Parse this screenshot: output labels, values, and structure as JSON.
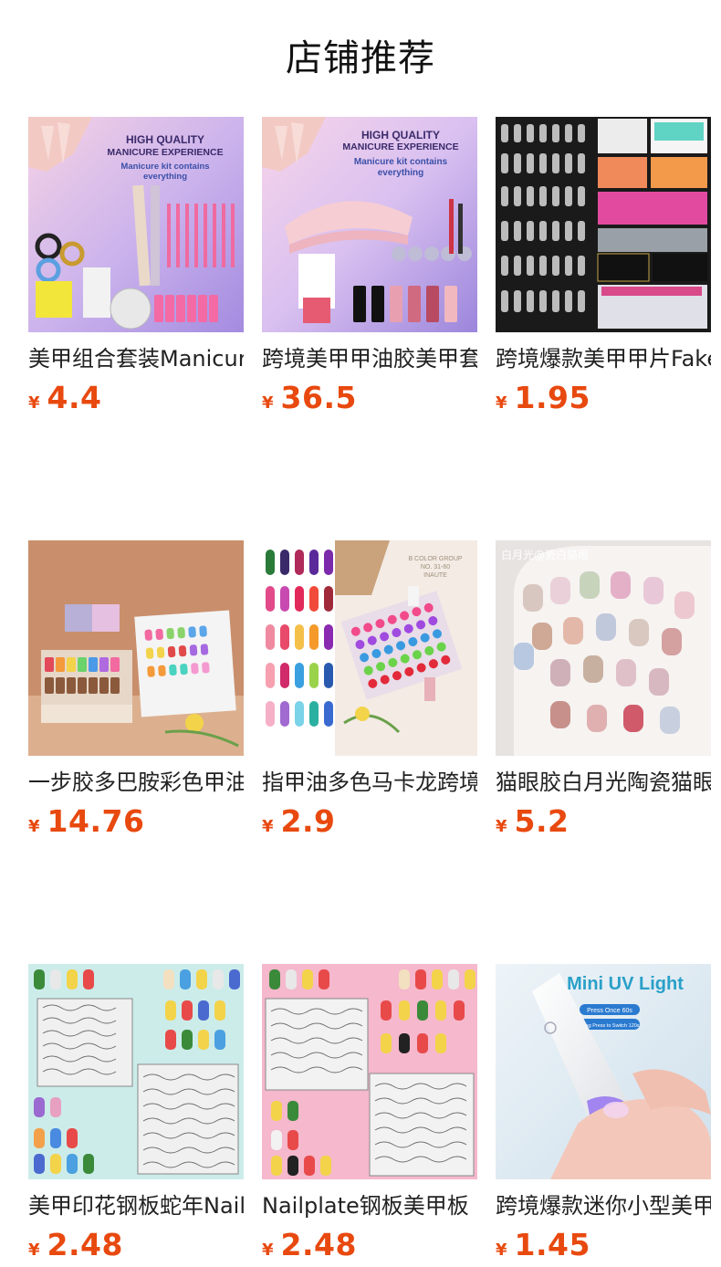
{
  "section": {
    "title": "店铺推荐"
  },
  "currency_symbol": "¥",
  "products": [
    {
      "name": "美甲组合套装Manicure",
      "price": "4.4",
      "image_text": {
        "headline1": "HIGH QUALITY",
        "headline2": "MANICURE EXPERIENCE",
        "sub1": "Manicure kit contains",
        "sub2": "everything"
      }
    },
    {
      "name": "跨境美甲甲油胶美甲套装",
      "price": "36.5",
      "image_text": {
        "headline1": "HIGH QUALITY",
        "headline2": "MANICURE EXPERIENCE",
        "sub1": "Manicure kit contains",
        "sub2": "everything"
      }
    },
    {
      "name": "跨境爆款美甲甲片Fake",
      "price": "1.95"
    },
    {
      "name": "一步胶多巴胺彩色甲油胶",
      "price": "14.76"
    },
    {
      "name": "指甲油多色马卡龙跨境",
      "price": "2.9",
      "image_text": {
        "box1": "B COLOR GROUP",
        "box2": "NO. 31-60",
        "box3": "INAUTE"
      }
    },
    {
      "name": "猫眼胶白月光陶瓷猫眼",
      "price": "5.2",
      "image_text": {
        "caption": "白月光@瓷白猫眼"
      }
    },
    {
      "name": "美甲印花钢板蛇年Nail",
      "price": "2.48"
    },
    {
      "name": "Nailplate钢板美甲板",
      "price": "2.48"
    },
    {
      "name": "跨境爆款迷你小型美甲灯",
      "price": "1.45",
      "image_text": {
        "headline": "Mini UV Light",
        "badge1": "Press Once 60s",
        "badge2": "Long Press to Switch 120s"
      }
    }
  ]
}
